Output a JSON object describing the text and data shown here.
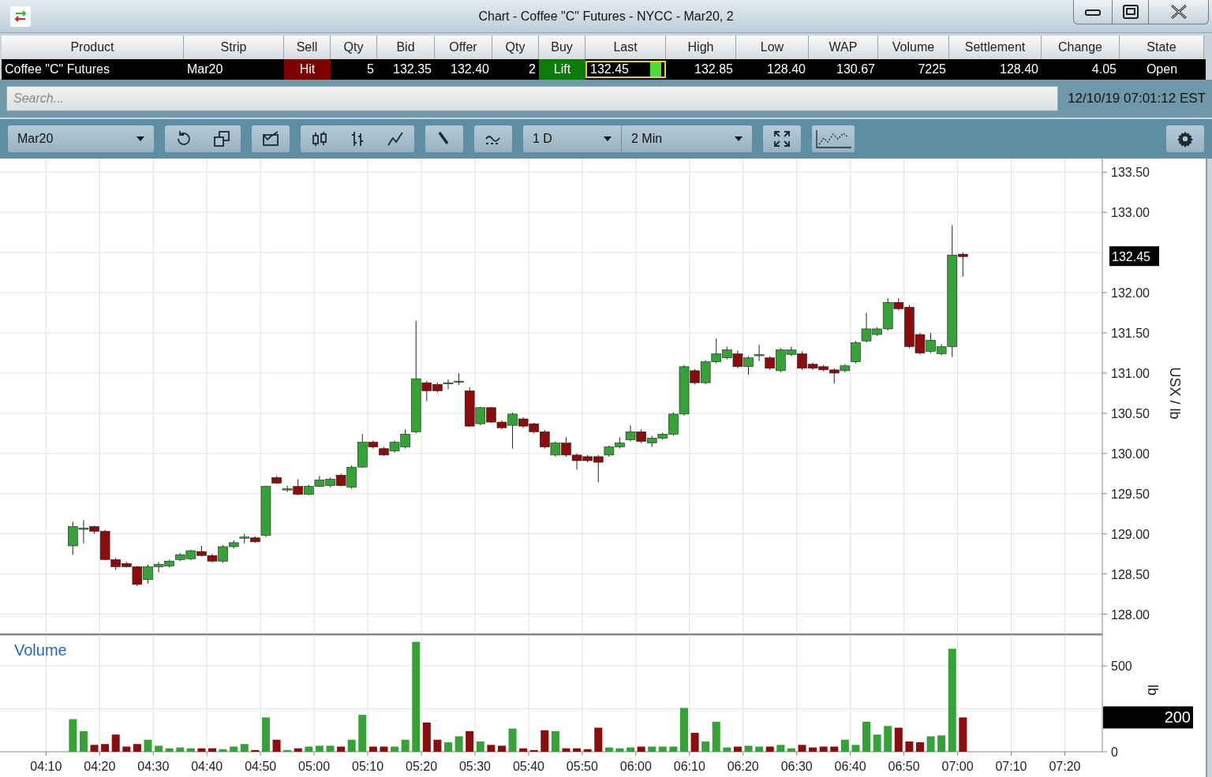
{
  "window": {
    "title": "Chart - Coffee \"C\" Futures - NYCC - Mar20, 2"
  },
  "quote_table": {
    "columns": [
      "Product",
      "Strip",
      "Sell",
      "Qty",
      "Bid",
      "Offer",
      "Qty",
      "Buy",
      "Last",
      "High",
      "Low",
      "WAP",
      "Volume",
      "Settlement",
      "Change",
      "State"
    ],
    "row": [
      {
        "text": "Coffee \"C\" Futures",
        "kind": "label"
      },
      {
        "text": "Mar20",
        "kind": "label"
      },
      {
        "text": "Hit",
        "kind": "sell"
      },
      {
        "text": "5",
        "kind": "number"
      },
      {
        "text": "132.35",
        "kind": "number"
      },
      {
        "text": "132.40",
        "kind": "number"
      },
      {
        "text": "2",
        "kind": "number"
      },
      {
        "text": "Lift",
        "kind": "buy"
      },
      {
        "text": "132.45",
        "kind": "last"
      },
      {
        "text": "132.85",
        "kind": "number"
      },
      {
        "text": "128.40",
        "kind": "number"
      },
      {
        "text": "130.67",
        "kind": "number"
      },
      {
        "text": "7225",
        "kind": "number"
      },
      {
        "text": "128.40",
        "kind": "number"
      },
      {
        "text": "4.05",
        "kind": "number"
      },
      {
        "text": "Open",
        "kind": "status"
      }
    ]
  },
  "search": {
    "placeholder": "Search...",
    "timestamp": "12/10/19 07:01:12 EST"
  },
  "toolbar": {
    "strip": "Mar20",
    "range": "1 D",
    "interval": "2 Min"
  },
  "price_chart": {
    "last_tag": "132.45",
    "chart_data": {
      "type": "candlestick",
      "ylabel": "USX / lb",
      "grid": true,
      "xlim": [
        242,
        447
      ],
      "ylim": [
        127.77,
        133.65
      ],
      "yticks": [
        {
          "value": 128,
          "label": "128.00"
        },
        {
          "value": 128.5,
          "label": "128.50"
        },
        {
          "value": 129,
          "label": "129.00"
        },
        {
          "value": 129.5,
          "label": "129.50"
        },
        {
          "value": 130,
          "label": "130.00"
        },
        {
          "value": 130.5,
          "label": "130.50"
        },
        {
          "value": 131,
          "label": "131.00"
        },
        {
          "value": 131.5,
          "label": "131.50"
        },
        {
          "value": 132,
          "label": "132.00"
        },
        {
          "value": 133,
          "label": "133.00"
        },
        {
          "value": 133.5,
          "label": "133.50"
        }
      ],
      "x": [
        255,
        257,
        259,
        261,
        263,
        265,
        267,
        269,
        271,
        273,
        275,
        277,
        279,
        281,
        283,
        285,
        287,
        289,
        291,
        293,
        295,
        297,
        299,
        301,
        303,
        305,
        307,
        309,
        311,
        313,
        315,
        317,
        319,
        321,
        323,
        325,
        327,
        329,
        331,
        333,
        335,
        337,
        339,
        341,
        343,
        345,
        347,
        349,
        351,
        353,
        355,
        357,
        359,
        361,
        363,
        365,
        367,
        369,
        371,
        373,
        375,
        377,
        379,
        381,
        383,
        385,
        387,
        389,
        391,
        393,
        395,
        397,
        399,
        401,
        403,
        405,
        407,
        409,
        411,
        413,
        415,
        417,
        419,
        421
      ],
      "ohlc": [
        [
          128.85,
          129.15,
          128.74,
          129.09
        ],
        [
          129.06,
          129.17,
          128.88,
          129.07
        ],
        [
          129.09,
          129.1,
          129.0,
          129.03
        ],
        [
          129.03,
          129.05,
          128.67,
          128.68
        ],
        [
          128.68,
          128.7,
          128.55,
          128.59
        ],
        [
          128.63,
          128.65,
          128.58,
          128.59
        ],
        [
          128.59,
          128.6,
          128.35,
          128.37
        ],
        [
          128.43,
          128.62,
          128.38,
          128.59
        ],
        [
          128.59,
          128.65,
          128.52,
          128.62
        ],
        [
          128.6,
          128.68,
          128.58,
          128.66
        ],
        [
          128.68,
          128.76,
          128.66,
          128.74
        ],
        [
          128.69,
          128.8,
          128.67,
          128.79
        ],
        [
          128.78,
          128.85,
          128.72,
          128.73
        ],
        [
          128.73,
          128.75,
          128.64,
          128.66
        ],
        [
          128.66,
          128.86,
          128.64,
          128.84
        ],
        [
          128.84,
          128.92,
          128.82,
          128.89
        ],
        [
          128.95,
          129.0,
          128.88,
          128.96
        ],
        [
          128.95,
          128.97,
          128.89,
          128.9
        ],
        [
          128.98,
          129.6,
          128.96,
          129.59
        ],
        [
          129.7,
          129.72,
          129.62,
          129.63
        ],
        [
          129.55,
          129.6,
          129.52,
          129.56
        ],
        [
          129.59,
          129.68,
          129.48,
          129.49
        ],
        [
          129.49,
          129.61,
          129.48,
          129.59
        ],
        [
          129.59,
          129.72,
          129.58,
          129.67
        ],
        [
          129.6,
          129.7,
          129.58,
          129.68
        ],
        [
          129.73,
          129.75,
          129.59,
          129.6
        ],
        [
          129.58,
          129.85,
          129.56,
          129.83
        ],
        [
          129.83,
          130.24,
          129.82,
          130.14
        ],
        [
          130.14,
          130.16,
          130.06,
          130.08
        ],
        [
          130.06,
          130.08,
          129.97,
          129.98
        ],
        [
          130.03,
          130.16,
          130.01,
          130.14
        ],
        [
          130.08,
          130.3,
          130.06,
          130.24
        ],
        [
          130.27,
          131.65,
          130.25,
          130.93
        ],
        [
          130.88,
          130.9,
          130.65,
          130.78
        ],
        [
          130.86,
          130.88,
          130.76,
          130.78
        ],
        [
          130.87,
          130.92,
          130.8,
          130.88
        ],
        [
          130.89,
          131.0,
          130.85,
          130.9
        ],
        [
          130.78,
          130.82,
          130.33,
          130.34
        ],
        [
          130.37,
          130.58,
          130.35,
          130.57
        ],
        [
          130.57,
          130.58,
          130.38,
          130.39
        ],
        [
          130.39,
          130.41,
          130.3,
          130.32
        ],
        [
          130.35,
          130.51,
          130.06,
          130.49
        ],
        [
          130.43,
          130.45,
          130.32,
          130.34
        ],
        [
          130.37,
          130.38,
          130.25,
          130.27
        ],
        [
          130.27,
          130.29,
          130.06,
          130.08
        ],
        [
          129.98,
          130.15,
          129.96,
          130.13
        ],
        [
          130.13,
          130.2,
          129.96,
          129.98
        ],
        [
          129.98,
          130.0,
          129.8,
          129.91
        ],
        [
          129.96,
          129.98,
          129.89,
          129.91
        ],
        [
          129.96,
          129.98,
          129.64,
          129.89
        ],
        [
          129.98,
          130.1,
          129.96,
          130.08
        ],
        [
          130.08,
          130.2,
          130.06,
          130.13
        ],
        [
          130.17,
          130.35,
          130.15,
          130.27
        ],
        [
          130.27,
          130.3,
          130.13,
          130.15
        ],
        [
          130.13,
          130.22,
          130.08,
          130.19
        ],
        [
          130.19,
          130.26,
          130.17,
          130.24
        ],
        [
          130.24,
          130.51,
          130.22,
          130.49
        ],
        [
          130.49,
          131.1,
          130.47,
          131.08
        ],
        [
          131.03,
          131.05,
          130.86,
          130.88
        ],
        [
          130.88,
          131.16,
          130.86,
          131.14
        ],
        [
          131.14,
          131.43,
          131.12,
          131.24
        ],
        [
          131.19,
          131.33,
          131.17,
          131.29
        ],
        [
          131.24,
          131.28,
          131.06,
          131.08
        ],
        [
          131.08,
          131.21,
          130.98,
          131.19
        ],
        [
          131.22,
          131.35,
          131.15,
          131.23
        ],
        [
          131.19,
          131.21,
          131.04,
          131.06
        ],
        [
          131.03,
          131.31,
          131.01,
          131.29
        ],
        [
          131.23,
          131.33,
          131.21,
          131.29
        ],
        [
          131.24,
          131.27,
          131.04,
          131.06
        ],
        [
          131.11,
          131.13,
          131.04,
          131.06
        ],
        [
          131.08,
          131.1,
          131.02,
          131.04
        ],
        [
          131.04,
          131.06,
          130.87,
          131.0
        ],
        [
          131.03,
          131.11,
          131.01,
          131.09
        ],
        [
          131.14,
          131.4,
          131.12,
          131.38
        ],
        [
          131.4,
          131.75,
          131.38,
          131.55
        ],
        [
          131.48,
          131.57,
          131.46,
          131.55
        ],
        [
          131.55,
          131.93,
          131.53,
          131.88
        ],
        [
          131.88,
          131.93,
          131.78,
          131.8
        ],
        [
          131.82,
          131.85,
          131.31,
          131.33
        ],
        [
          131.48,
          131.5,
          131.23,
          131.25
        ],
        [
          131.27,
          131.5,
          131.25,
          131.41
        ],
        [
          131.24,
          131.36,
          131.22,
          131.33
        ],
        [
          131.33,
          132.84,
          131.2,
          132.47
        ],
        [
          132.48,
          132.5,
          132.2,
          132.45
        ]
      ]
    }
  },
  "volume_chart": {
    "title": "Volume",
    "last_tag": "200",
    "chart_data": {
      "type": "bar",
      "ylabel": "lb",
      "grid": true,
      "xlim": [
        242,
        447
      ],
      "ylim": [
        0,
        680
      ],
      "yticks": [
        0,
        500
      ],
      "xticks": [
        {
          "value": 250,
          "label": "04:10"
        },
        {
          "value": 260,
          "label": "04:20"
        },
        {
          "value": 270,
          "label": "04:30"
        },
        {
          "value": 280,
          "label": "04:40"
        },
        {
          "value": 290,
          "label": "04:50"
        },
        {
          "value": 300,
          "label": "05:00"
        },
        {
          "value": 310,
          "label": "05:10"
        },
        {
          "value": 320,
          "label": "05:20"
        },
        {
          "value": 330,
          "label": "05:30"
        },
        {
          "value": 340,
          "label": "05:40"
        },
        {
          "value": 350,
          "label": "05:50"
        },
        {
          "value": 360,
          "label": "06:00"
        },
        {
          "value": 370,
          "label": "06:10"
        },
        {
          "value": 380,
          "label": "06:20"
        },
        {
          "value": 390,
          "label": "06:30"
        },
        {
          "value": 400,
          "label": "06:40"
        },
        {
          "value": 410,
          "label": "06:50"
        },
        {
          "value": 420,
          "label": "07:00"
        },
        {
          "value": 430,
          "label": "07:10"
        },
        {
          "value": 440,
          "label": "07:20"
        }
      ],
      "x": [
        255,
        257,
        259,
        261,
        263,
        265,
        267,
        269,
        271,
        273,
        275,
        277,
        279,
        281,
        283,
        285,
        287,
        289,
        291,
        293,
        295,
        297,
        299,
        301,
        303,
        305,
        307,
        309,
        311,
        313,
        315,
        317,
        319,
        321,
        323,
        325,
        327,
        329,
        331,
        333,
        335,
        337,
        339,
        341,
        343,
        345,
        347,
        349,
        351,
        353,
        355,
        357,
        359,
        361,
        363,
        365,
        367,
        369,
        371,
        373,
        375,
        377,
        379,
        381,
        383,
        385,
        387,
        389,
        391,
        393,
        395,
        397,
        399,
        401,
        403,
        405,
        407,
        409,
        411,
        413,
        415,
        417,
        419,
        421
      ],
      "series": [
        {
          "color": "#36a136",
          "values": [
            190,
            120,
            null,
            null,
            null,
            null,
            null,
            70,
            35,
            20,
            25,
            20,
            null,
            null,
            15,
            30,
            45,
            null,
            200,
            null,
            10,
            null,
            30,
            35,
            35,
            null,
            70,
            215,
            null,
            null,
            30,
            70,
            640,
            null,
            null,
            55,
            90,
            null,
            60,
            null,
            null,
            135,
            null,
            null,
            null,
            120,
            null,
            null,
            null,
            null,
            25,
            20,
            25,
            null,
            30,
            30,
            30,
            255,
            null,
            60,
            175,
            25,
            null,
            35,
            30,
            null,
            40,
            20,
            null,
            null,
            null,
            null,
            70,
            40,
            175,
            100,
            150,
            null,
            null,
            null,
            90,
            95,
            600,
            null
          ]
        },
        {
          "color": "#8a0c0c",
          "values": [
            null,
            null,
            40,
            45,
            100,
            30,
            45,
            null,
            null,
            null,
            null,
            null,
            20,
            20,
            null,
            null,
            null,
            10,
            null,
            70,
            null,
            20,
            null,
            null,
            null,
            30,
            null,
            null,
            30,
            30,
            null,
            null,
            null,
            170,
            70,
            null,
            null,
            120,
            null,
            40,
            35,
            null,
            20,
            10,
            125,
            null,
            20,
            20,
            15,
            140,
            null,
            null,
            null,
            30,
            null,
            null,
            null,
            null,
            110,
            null,
            null,
            null,
            30,
            null,
            null,
            30,
            null,
            null,
            40,
            25,
            30,
            30,
            null,
            null,
            null,
            null,
            null,
            140,
            60,
            55,
            null,
            null,
            null,
            200
          ]
        }
      ]
    }
  }
}
